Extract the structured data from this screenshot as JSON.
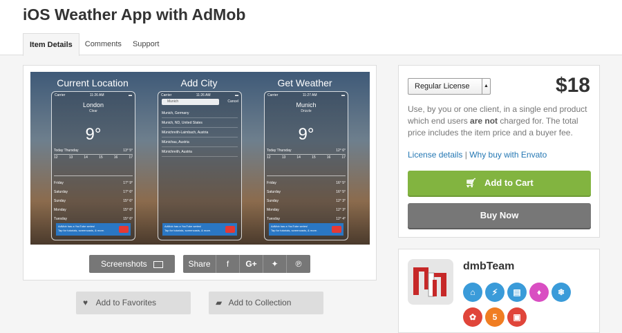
{
  "page": {
    "title": "iOS Weather App with AdMob",
    "tabs": [
      {
        "label": "Item Details",
        "active": true
      },
      {
        "label": "Comments",
        "active": false
      },
      {
        "label": "Support",
        "active": false
      }
    ]
  },
  "preview": {
    "panels": [
      {
        "title": "Current Location"
      },
      {
        "title": "Add City"
      },
      {
        "title": "Get Weather"
      }
    ],
    "screen1": {
      "carrier": "Carrier",
      "time": "11:26 AM",
      "city": "London",
      "condition": "Clear",
      "temp": "9°",
      "today": "Today  Thursday",
      "today_temps": "13°  5°",
      "hours": [
        "12",
        "13",
        "14",
        "15",
        "16",
        "17"
      ],
      "days": [
        {
          "name": "Friday",
          "temps": "17°  9°"
        },
        {
          "name": "Saturday",
          "temps": "17°  6°"
        },
        {
          "name": "Sunday",
          "temps": "15°  6°"
        },
        {
          "name": "Monday",
          "temps": "15°  6°"
        },
        {
          "name": "Tuesday",
          "temps": "15°  6°"
        }
      ],
      "ad_line1": "AdMob has a YouTube series!",
      "ad_line2": "Tap for tutorials, screencasts, & more."
    },
    "screen2": {
      "carrier": "Carrier",
      "time": "11:26 AM",
      "search_text": "Munich",
      "cancel": "Cancel",
      "results": [
        "Munich, Germany",
        "Munich, ND, United States",
        "Münichreith-Laimbach, Austria",
        "Münichau, Austria",
        "Münichreith, Austria"
      ],
      "ad_line1": "AdMob has a YouTube series!",
      "ad_line2": "Tap for tutorials, screencasts, & more."
    },
    "screen3": {
      "carrier": "Carrier",
      "time": "11:27 AM",
      "city": "Munich",
      "condition": "Drizzle",
      "temp": "9°",
      "today": "Today  Thursday",
      "today_temps": "12°  6°",
      "hours": [
        "12",
        "13",
        "14",
        "15",
        "16",
        "17"
      ],
      "days": [
        {
          "name": "Friday",
          "temps": "16°  5°"
        },
        {
          "name": "Saturday",
          "temps": "16°  5°"
        },
        {
          "name": "Sunday",
          "temps": "12°  3°"
        },
        {
          "name": "Monday",
          "temps": "12°  3°"
        },
        {
          "name": "Tuesday",
          "temps": "12°  4°"
        }
      ],
      "ad_line1": "AdMob has a YouTube series!",
      "ad_line2": "Tap for tutorials, screencasts, & more."
    }
  },
  "actions": {
    "screenshots": "Screenshots",
    "share": "Share",
    "share_icons": [
      "facebook-icon",
      "google-plus-icon",
      "twitter-icon",
      "pinterest-icon"
    ],
    "favorites": "Add to Favorites",
    "collection": "Add to Collection"
  },
  "purchase": {
    "license": "Regular License",
    "price": "$18",
    "desc_part1": "Use, by you or one client, in a single end product which end users ",
    "desc_bold": "are not",
    "desc_part2": " charged for. The total price includes the item price and a buyer fee.",
    "license_details": "License details",
    "separator": "|",
    "why_buy": "Why buy with Envato",
    "add_to_cart": "Add to Cart",
    "buy_now": "Buy Now",
    "cart_color": "#82b440"
  },
  "author": {
    "name": "dmbTeam",
    "badges": [
      {
        "icon": "author-badge-icon",
        "color": "#3a9bd9",
        "text": ""
      },
      {
        "icon": "lightning-badge-icon",
        "color": "#3a9bd9",
        "text": ""
      },
      {
        "icon": "printer-badge-icon",
        "color": "#3a9bd9",
        "text": ""
      },
      {
        "icon": "gem-badge-icon",
        "color": "#d94ec2",
        "text": ""
      },
      {
        "icon": "snowflake-badge-icon",
        "color": "#3a9bd9",
        "text": ""
      },
      {
        "icon": "paw-badge-icon",
        "color": "#e0453a",
        "text": ""
      },
      {
        "icon": "years-badge-icon",
        "color": "#f07d22",
        "text": "5"
      },
      {
        "icon": "sales-badge-icon",
        "color": "#e0453a",
        "text": ""
      }
    ]
  }
}
